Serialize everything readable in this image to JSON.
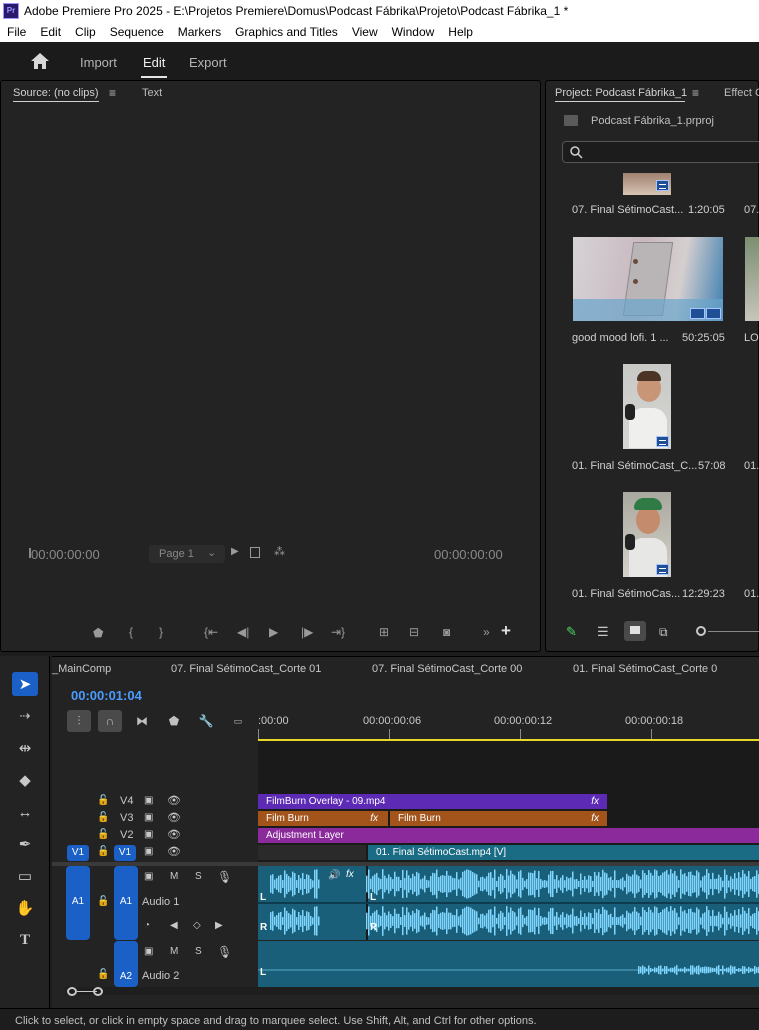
{
  "window": {
    "app_icon": "Pr",
    "title": "Adobe Premiere Pro 2025 - E:\\Projetos Premiere\\Domus\\Podcast Fábrika\\Projeto\\Podcast Fábrika_1 *"
  },
  "menu": [
    "File",
    "Edit",
    "Clip",
    "Sequence",
    "Markers",
    "Graphics and Titles",
    "View",
    "Window",
    "Help"
  ],
  "workspace": {
    "home_icon": "home-icon",
    "tabs": [
      "Import",
      "Edit",
      "Export"
    ],
    "active": "Edit"
  },
  "source": {
    "tab_label": "Source: (no clips)",
    "text_tab": "Text",
    "timecode_left": "00:00:00:00",
    "page_select": "Page 1",
    "timecode_right": "00:00:00:00"
  },
  "project": {
    "tab_label": "Project: Podcast Fábrika_1",
    "effect_tab": "Effect C",
    "file_name": "Podcast Fábrika_1.prproj",
    "search_placeholder": "",
    "items": [
      {
        "name": "07. Final SétimoCast...",
        "duration": "1:20:05",
        "partial": "07."
      },
      {
        "name": "good mood lofi. 1 ...",
        "duration": "50:25:05",
        "partial": "LO"
      },
      {
        "name": "01. Final SétimoCast_C...",
        "duration": "57:08",
        "partial": "01."
      },
      {
        "name": "01. Final SétimoCas...",
        "duration": "12:29:23",
        "partial": "01."
      }
    ]
  },
  "timeline": {
    "sequence_tabs": [
      "_MainComp",
      "07. Final SétimoCast_Corte 01",
      "07. Final SétimoCast_Corte 00",
      "01. Final SétimoCast_Corte 0"
    ],
    "timecode": "00:00:01:04",
    "ruler": [
      ":00:00",
      "00:00:00:06",
      "00:00:00:12",
      "00:00:00:18"
    ],
    "video_tracks": [
      {
        "label": "V4",
        "clips": [
          {
            "name": "FilmBurn Overlay - 09.mp4",
            "fx": "fx"
          }
        ]
      },
      {
        "label": "V3",
        "clips": [
          {
            "name": "Film Burn",
            "fx": "fx"
          },
          {
            "name": "Film Burn",
            "fx": "fx"
          }
        ]
      },
      {
        "label": "V2",
        "clips": [
          {
            "name": "Adjustment Layer"
          }
        ]
      },
      {
        "label": "V1",
        "source_target": "V1",
        "clips": [
          {
            "name": "01. Final SétimoCast.mp4 [V]"
          }
        ]
      }
    ],
    "audio_tracks": [
      {
        "label": "A1",
        "source_target": "A1",
        "name": "Audio 1",
        "m": "M",
        "s": "S",
        "channel_l": "L",
        "channel_r": "R",
        "fx": "fx"
      },
      {
        "label": "A2",
        "name": "Audio 2",
        "m": "M",
        "s": "S",
        "channel_l": "L"
      }
    ]
  },
  "status": "Click to select, or click in empty space and drag to marquee select. Use Shift, Alt, and Ctrl for other options.",
  "colors": {
    "accent_blue": "#1b60c6",
    "timecode_blue": "#4b9cff",
    "clip_purple": "#5c2ab5",
    "clip_orange": "#a2541a",
    "clip_magenta": "#8a2a9b",
    "clip_teal": "#1a6c84",
    "audio_teal": "#1a5f7a",
    "waveform": "#7fd6ff",
    "playhead_range_yellow": "#e8d629"
  }
}
